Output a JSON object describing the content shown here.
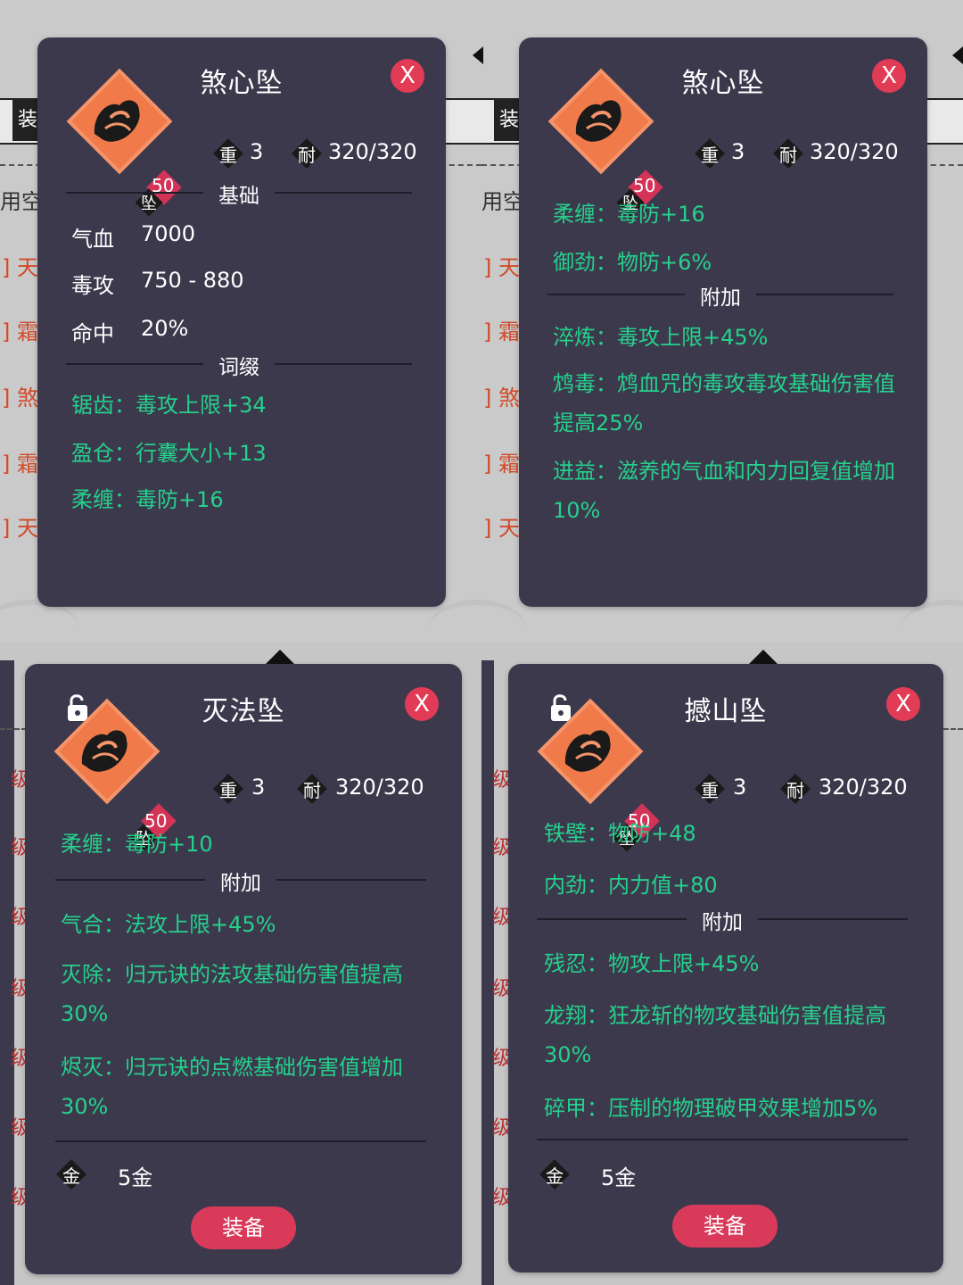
{
  "background": {
    "tab_left": "装",
    "tab_right": "装",
    "hint_left": "用空",
    "hint_right": "用空",
    "list_left": [
      "] 天",
      "] 霜",
      "] 煞",
      "] 霜",
      "] 天"
    ],
    "list_right": [
      "] 天",
      "] 霜",
      "] 煞",
      "] 霜",
      "] 天"
    ],
    "level_marks": [
      "级",
      "级",
      "级",
      "级",
      "级",
      "级",
      "级"
    ]
  },
  "cards": [
    {
      "title": "煞心坠",
      "close": "X",
      "level": "50",
      "slot": "坠",
      "weight_label": "重",
      "weight": "3",
      "durability_label": "耐",
      "durability": "320/320",
      "section_base": "基础",
      "base_stats": [
        {
          "name": "气血",
          "value": "7000"
        },
        {
          "name": "毒攻",
          "value": "750 - 880"
        },
        {
          "name": "命中",
          "value": "20%"
        }
      ],
      "section_affix": "词缀",
      "affixes": [
        "锯齿：毒攻上限+34",
        "盈仓：行囊大小+13",
        "柔缠：毒防+16"
      ]
    },
    {
      "title": "煞心坠",
      "close": "X",
      "level": "50",
      "slot": "坠",
      "weight_label": "重",
      "weight": "3",
      "durability_label": "耐",
      "durability": "320/320",
      "affixes": [
        "柔缠：毒防+16",
        "御劲：物防+6%"
      ],
      "section_extra": "附加",
      "extras": [
        "淬炼：毒攻上限+45%",
        "鸩毒：鸩血咒的毒攻毒攻基础伤害值提高25%",
        "进益：滋养的气血和内力回复值增加10%"
      ]
    },
    {
      "title": "灭法坠",
      "close": "X",
      "level": "50",
      "slot": "坠",
      "weight_label": "重",
      "weight": "3",
      "durability_label": "耐",
      "durability": "320/320",
      "affixes": [
        "柔缠：毒防+10"
      ],
      "section_extra": "附加",
      "extras": [
        "气合：法攻上限+45%",
        "灭除：归元诀的法攻基础伤害值提高30%",
        "烬灭：归元诀的点燃基础伤害值增加30%"
      ],
      "gold_label": "金",
      "gold": "5金",
      "equip": "装备"
    },
    {
      "title": "撼山坠",
      "close": "X",
      "level": "50",
      "slot": "坠",
      "weight_label": "重",
      "weight": "3",
      "durability_label": "耐",
      "durability": "320/320",
      "affixes": [
        "铁壁：物防+48",
        "内劲：内力值+80"
      ],
      "section_extra": "附加",
      "extras": [
        "残忍：物攻上限+45%",
        "龙翔：狂龙斩的物攻基础伤害值提高30%",
        "碎甲：压制的物理破甲效果增加5%"
      ],
      "gold_label": "金",
      "gold": "5金",
      "equip": "装备"
    }
  ],
  "colors": {
    "card_bg": "#3c394d",
    "green_text": "#26d08c",
    "accent_red": "#e23b55",
    "icon_orange": "#f07a4a"
  },
  "icons": [
    "close-icon",
    "pendant-icon",
    "lock-icon",
    "weight-icon",
    "durability-icon",
    "gold-icon"
  ]
}
